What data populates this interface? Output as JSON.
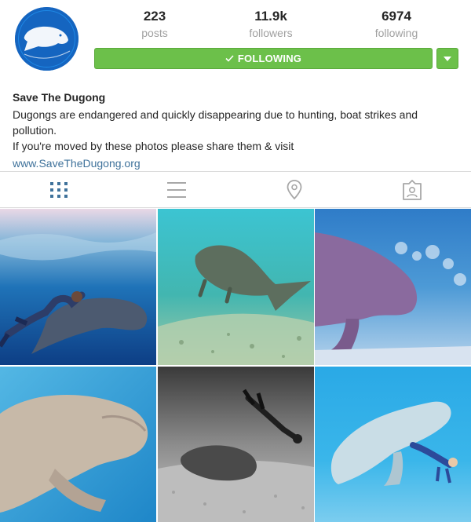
{
  "profile": {
    "avatar_icon": "dugong-logo-avatar",
    "stats": [
      {
        "count": "223",
        "label": "posts"
      },
      {
        "count": "11.9k",
        "label": "followers"
      },
      {
        "count": "6974",
        "label": "following"
      }
    ],
    "follow_button_label": "FOLLOWING",
    "follow_check_icon": "check-icon",
    "dropdown_icon": "caret-down-icon",
    "name": "Save The Dugong",
    "bio_line1": "Dugongs are endangered and quickly disappearing due to hunting, boat strikes and pollution.",
    "bio_line2": "If you're moved by these photos please share them & visit",
    "website": "www.SaveTheDugong.org"
  },
  "tabs": [
    {
      "icon": "grid-icon",
      "active": true
    },
    {
      "icon": "list-icon",
      "active": false
    },
    {
      "icon": "location-pin-icon",
      "active": false
    },
    {
      "icon": "tagged-user-icon",
      "active": false
    }
  ],
  "colors": {
    "follow_green": "#6cc04a",
    "link_blue": "#3f729b",
    "active_tab": "#3f729b",
    "inactive_tab": "#a8a8a8"
  },
  "photos": [
    {
      "subject": "diver swimming with dugong"
    },
    {
      "subject": "dugong over seagrass"
    },
    {
      "subject": "dugong close-up"
    },
    {
      "subject": "dugong face close-up"
    },
    {
      "subject": "black and white diver with dugong"
    },
    {
      "subject": "dugong with snorkeler"
    }
  ]
}
